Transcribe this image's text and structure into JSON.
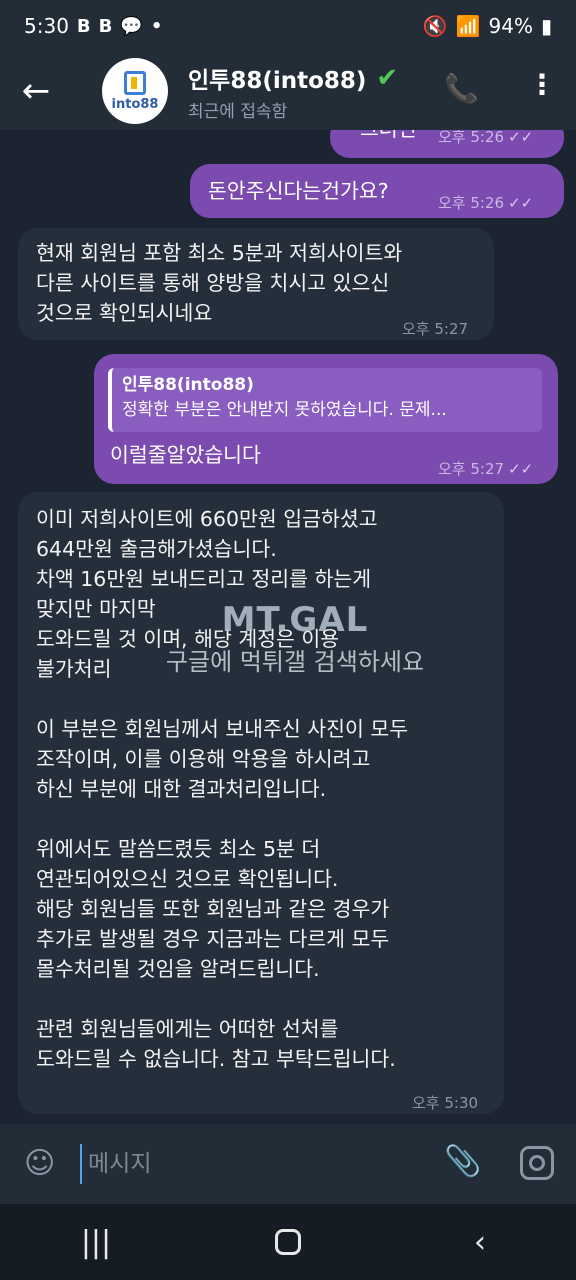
{
  "status_bar": {
    "time": "5:30",
    "left_icons": [
      "B",
      "B",
      "💬",
      "•"
    ],
    "battery": "94%"
  },
  "header": {
    "contact_name": "인투88(into88)",
    "status": "최근에 접속함",
    "avatar_text": "into88",
    "verified_icon": "check-mark-icon"
  },
  "messages": [
    {
      "id": "m1",
      "direction": "out",
      "text": "그러면",
      "time": "오후 5:26"
    },
    {
      "id": "m2",
      "direction": "out",
      "text": "돈안주신다는건가요?",
      "time": "오후 5:26"
    },
    {
      "id": "m3",
      "direction": "in",
      "text": "현재 회원님 포함 최소 5분과 저희사이트와\n다른 사이트를 통해 양방을 치시고 있으신\n것으로 확인되시네요",
      "time": "오후 5:27"
    },
    {
      "id": "m4",
      "direction": "out",
      "reply_name": "인투88(into88)",
      "reply_text": "정확한 부분은 안내받지 못하였습니다.  문제...",
      "text": "이럴줄알았습니다",
      "time": "오후 5:27"
    },
    {
      "id": "m5",
      "direction": "in",
      "text": "이미 저희사이트에 660만원 입금하셨고\n644만원 출금해가셨습니다.\n차액 16만원 보내드리고 정리를 하는게\n맞지만 마지막\n도와드릴 것 이며, 해당 계정은 이용\n불가처리\n\n이 부분은 회원님께서 보내주신 사진이 모두\n조작이며, 이를 이용해 악용을 하시려고\n하신 부분에 대한 결과처리입니다.\n\n위에서도 말씀드렸듯 최소 5분 더\n연관되어있으신 것으로 확인됩니다.\n해당 회원님들 또한 회원님과 같은 경우가\n추가로 발생될 경우 지금과는 다르게 모두\n몰수처리될 것임을 알려드립니다.\n\n관련 회원님들에게는 어떠한 선처를\n도와드릴 수 없습니다. 참고 부탁드립니다.",
      "time": "오후 5:30"
    }
  ],
  "watermark": {
    "logo": "MT.GAL",
    "text": "구글에 먹튀갤 검색하세요"
  },
  "input": {
    "placeholder": "메시지"
  }
}
